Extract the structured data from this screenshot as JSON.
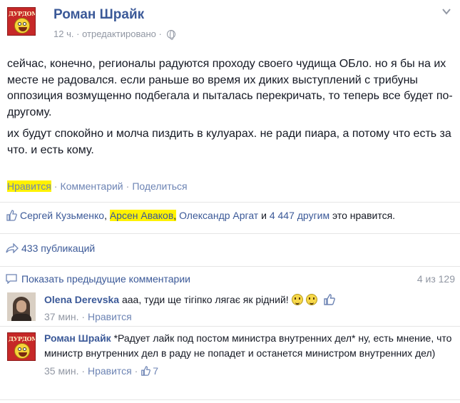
{
  "post": {
    "author": "Роман Шрайк",
    "avatar_logo_text": "ДУРДОМ",
    "time": "12 ч.",
    "dot": "·",
    "edited": "отредактировано",
    "paragraphs": [
      "сейчас, конечно, регионалы радуются проходу своего чудища ОБло. но я бы на их месте не радовался. если раньше во время их диких выступлений с трибуны оппозиция возмущенно подбегала и пыталась перекричать, то теперь все будет по-другому.",
      "их будут спокойно и молча пиздить в кулуарах. не ради пиара, а потому что есть за что. и есть кому."
    ],
    "actions": {
      "like": "Нравится",
      "comment": "Комментарий",
      "share": "Поделиться",
      "sep": "·"
    }
  },
  "likes": {
    "names": [
      "Сергей Кузьменко",
      "Арсен Аваков",
      "Олександр Аргат"
    ],
    "comma": ",",
    "and": "и",
    "others_link": "4 447 другим",
    "suffix": "это нравится."
  },
  "shares": {
    "label": "433 публикаций"
  },
  "previous_comments": {
    "label": "Показать предыдущие комментарии",
    "count": "4 из 129"
  },
  "comments": [
    {
      "author": "Olena Derevska",
      "text": "ааа, туди ще тігіпко лягає як рідний!",
      "time": "37 мин.",
      "like": "Нравится",
      "emojis": [
        "smiley-emoji",
        "smiley-emoji"
      ]
    },
    {
      "author": "Роман Шрайк",
      "avatar_logo_text": "ДУРДОМ",
      "text": "*Радует лайк под постом министра внутренних дел* ну, есть мнение, что министр внутренних дел в раду не попадет и останется министром внутренних дел)",
      "time": "35 мин.",
      "like": "Нравится",
      "like_count": "7"
    }
  ],
  "colors": {
    "link": "#3b5998",
    "muted": "#9197a3",
    "highlight": "#fff200",
    "text": "#141823"
  },
  "icons": [
    "globe-icon",
    "chevron-down-icon",
    "thumbs-up-icon",
    "share-arrow-icon",
    "comment-bubble-icon",
    "smiley-emoji",
    "like-thumb-icon"
  ]
}
